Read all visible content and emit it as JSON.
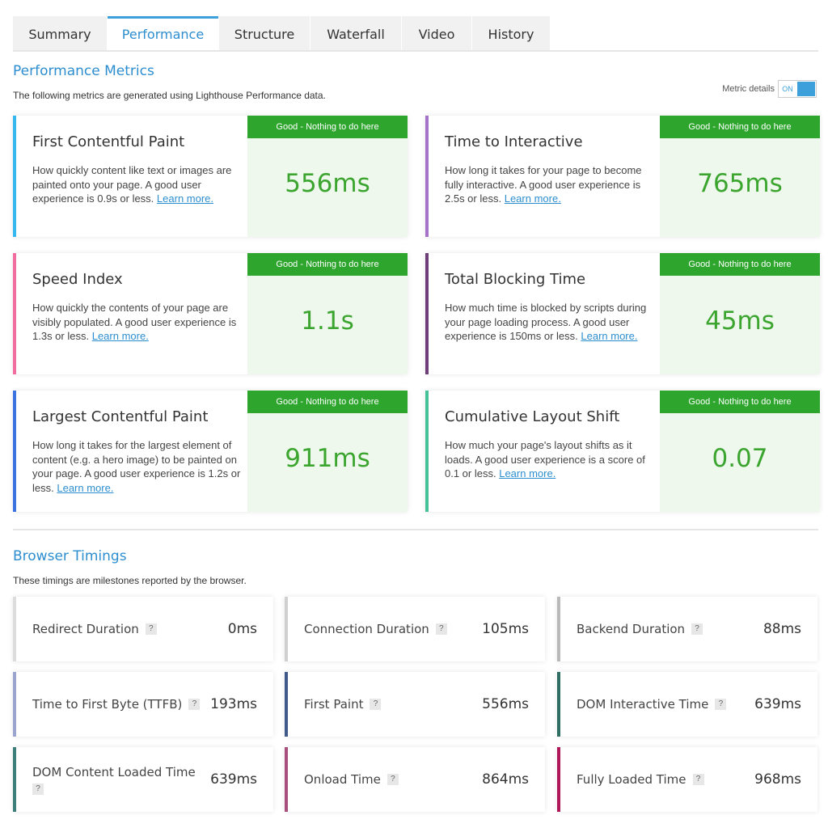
{
  "tabs": [
    {
      "label": "Summary",
      "active": false
    },
    {
      "label": "Performance",
      "active": true
    },
    {
      "label": "Structure",
      "active": false
    },
    {
      "label": "Waterfall",
      "active": false
    },
    {
      "label": "Video",
      "active": false
    },
    {
      "label": "History",
      "active": false
    }
  ],
  "performance": {
    "title": "Performance Metrics",
    "description": "The following metrics are generated using Lighthouse Performance data.",
    "toggle": {
      "label": "Metric details",
      "state": "ON",
      "color": "#3ea0db"
    },
    "grade_color": "#2ea62e",
    "metrics": [
      {
        "title": "First Contentful Paint",
        "desc": "How quickly content like text or images are painted onto your page. A good user experience is 0.9s or less.",
        "learn": "Learn more.",
        "grade": "Good - Nothing to do here",
        "value": "556ms",
        "color": "#35b8ef"
      },
      {
        "title": "Time to Interactive",
        "desc": "How long it takes for your page to become fully interactive. A good user experience is 2.5s or less.",
        "learn": "Learn more.",
        "grade": "Good - Nothing to do here",
        "value": "765ms",
        "color": "#a572c9"
      },
      {
        "title": "Speed Index",
        "desc": "How quickly the contents of your page are visibly populated. A good user experience is 1.3s or less.",
        "learn": "Learn more.",
        "grade": "Good - Nothing to do here",
        "value": "1.1s",
        "color": "#f26ca0"
      },
      {
        "title": "Total Blocking Time",
        "desc": "How much time is blocked by scripts during your page loading process. A good user experience is 150ms or less.",
        "learn": "Learn more.",
        "grade": "Good - Nothing to do here",
        "value": "45ms",
        "color": "#6e3d7a"
      },
      {
        "title": "Largest Contentful Paint",
        "desc": "How long it takes for the largest element of content (e.g. a hero image) to be painted on your page. A good user experience is 1.2s or less.",
        "learn": "Learn more.",
        "grade": "Good - Nothing to do here",
        "value": "911ms",
        "color": "#3b74e0"
      },
      {
        "title": "Cumulative Layout Shift",
        "desc": "How much your page's layout shifts as it loads. A good user experience is a score of 0.1 or less.",
        "learn": "Learn more.",
        "grade": "Good - Nothing to do here",
        "value": "0.07",
        "color": "#45c29a"
      }
    ]
  },
  "browser": {
    "title": "Browser Timings",
    "description": "These timings are milestones reported by the browser.",
    "help_glyph": "?",
    "timings": [
      {
        "label": "Redirect Duration",
        "value": "0ms",
        "color": "#dcdcdc"
      },
      {
        "label": "Connection Duration",
        "value": "105ms",
        "color": "#d0d0d0"
      },
      {
        "label": "Backend Duration",
        "value": "88ms",
        "color": "#b9b9b9"
      },
      {
        "label": "Time to First Byte (TTFB)",
        "value": "193ms",
        "color": "#9ba3cf"
      },
      {
        "label": "First Paint",
        "value": "556ms",
        "color": "#3f5a8a"
      },
      {
        "label": "DOM Interactive Time",
        "value": "639ms",
        "color": "#2f6e62"
      },
      {
        "label": "DOM Content Loaded Time",
        "value": "639ms",
        "color": "#3c7f7a"
      },
      {
        "label": "Onload Time",
        "value": "864ms",
        "color": "#a84f7e"
      },
      {
        "label": "Fully Loaded Time",
        "value": "968ms",
        "color": "#b0185a"
      }
    ]
  }
}
